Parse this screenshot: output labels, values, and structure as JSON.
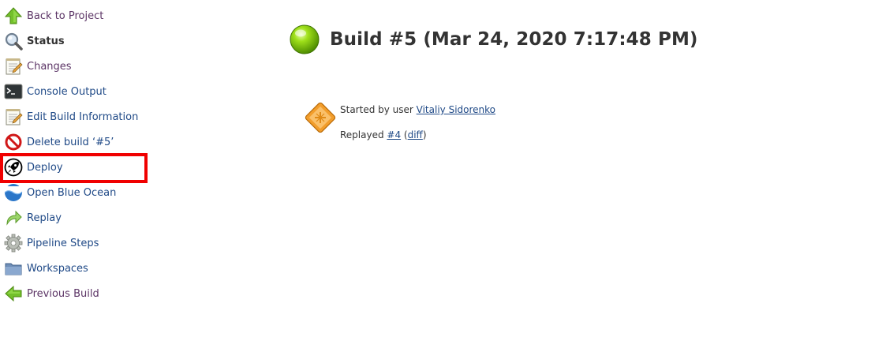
{
  "sidebar": {
    "items": [
      {
        "label": "Back to Project",
        "icon": "up-arrow-icon"
      },
      {
        "label": "Status",
        "icon": "search-icon"
      },
      {
        "label": "Changes",
        "icon": "notepad-icon"
      },
      {
        "label": "Console Output",
        "icon": "terminal-icon"
      },
      {
        "label": "Edit Build Information",
        "icon": "notepad-icon"
      },
      {
        "label": "Delete build ‘#5’",
        "icon": "no-entry-icon"
      },
      {
        "label": "Deploy",
        "icon": "rocket-icon"
      },
      {
        "label": "Open Blue Ocean",
        "icon": "blue-ocean-icon"
      },
      {
        "label": "Replay",
        "icon": "replay-arrow-icon"
      },
      {
        "label": "Pipeline Steps",
        "icon": "gear-icon"
      },
      {
        "label": "Workspaces",
        "icon": "folder-icon"
      },
      {
        "label": "Previous Build",
        "icon": "left-arrow-icon"
      }
    ]
  },
  "build": {
    "status_icon": "green-ball-icon",
    "title": "Build #5 (Mar 24, 2020 7:17:48 PM)",
    "started_prefix": "Started by user ",
    "started_user": "Vitaliy Sidorenko",
    "replayed_prefix": "Replayed ",
    "replayed_build": "#4",
    "diff_open": " (",
    "diff_label": "diff",
    "diff_close": ")"
  },
  "colors": {
    "link": "#204a87",
    "visited_link": "#5c3566",
    "highlight": "#f00000",
    "status_ball": "#7ac70c"
  }
}
